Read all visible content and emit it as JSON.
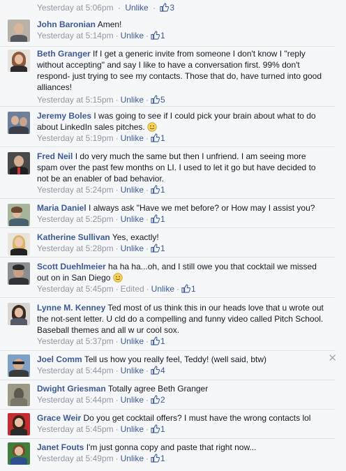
{
  "colors": {
    "link": "#3b5998",
    "meta": "#9197a3",
    "background": "#f6f7f9"
  },
  "labels": {
    "unlike": "Unlike",
    "edited": "Edited",
    "smiley": "🙂"
  },
  "partial": {
    "time": "Yesterday at 5:06pm",
    "likes": "3"
  },
  "comments": [
    {
      "author": "John Baronian",
      "text": "Amen!",
      "time": "Yesterday at 5:14pm",
      "likes": "1"
    },
    {
      "author": "Beth Granger",
      "text": "If I get a generic invite from someone I don't know I \"reply without accepting\" and say I like to have a conversation first. 99% don't respond- just trying to see my contacts. Those that do, have turned into good alliances!",
      "time": "Yesterday at 5:15pm",
      "likes": "5"
    },
    {
      "author": "Jeremy Boles",
      "text": "I was going to see if I could pick your brain about what to do about LinkedIn sales pitches.",
      "time": "Yesterday at 5:19pm",
      "likes": "1"
    },
    {
      "author": "Fred Neil",
      "text": "I do very much the same but then I unfriend. I am seeing more spam over the past few months on LI. I used to let it go but have decided to not be an enabler of bad behavior.",
      "time": "Yesterday at 5:24pm",
      "likes": "1"
    },
    {
      "author": "Maria Daniel",
      "text": "I always ask \"Have we met before? or How may I assist you?",
      "time": "Yesterday at 5:25pm",
      "likes": "1"
    },
    {
      "author": "Katherine Sullivan",
      "text": "Yes, exactly!",
      "time": "Yesterday at 5:28pm",
      "likes": "1"
    },
    {
      "author": "Scott Duehlmeier",
      "text": "ha ha ha...oh, and I still owe you that cocktail we missed out on in San Diego",
      "time": "Yesterday at 5:45pm",
      "likes": "1"
    },
    {
      "author": "Lynne M. Kenney",
      "text": "Ted most of us think this in our heads love that u wrote out the not-sent letter. U cld do a compelling and funny video called Pitch School. Baseball themes and all w ur cool sox.",
      "time": "Yesterday at 5:37pm",
      "likes": "1"
    },
    {
      "author": "Joel Comm",
      "text": "Tell us how you really feel, Teddy! (well said, btw)",
      "time": "Yesterday at 5:44pm",
      "likes": "4"
    },
    {
      "author": "Dwight Griesman",
      "text": "Totally agree Beth Granger",
      "time": "Yesterday at 5:44pm",
      "likes": "2"
    },
    {
      "author": "Grace Weir",
      "text": "Do you get cocktail offers? I must have the wrong contacts lol",
      "time": "Yesterday at 5:45pm",
      "likes": "1"
    },
    {
      "author": "Janet Fouts",
      "text": "I'm just gonna copy and paste that right now...",
      "time": "Yesterday at 5:49pm",
      "likes": "1"
    }
  ]
}
